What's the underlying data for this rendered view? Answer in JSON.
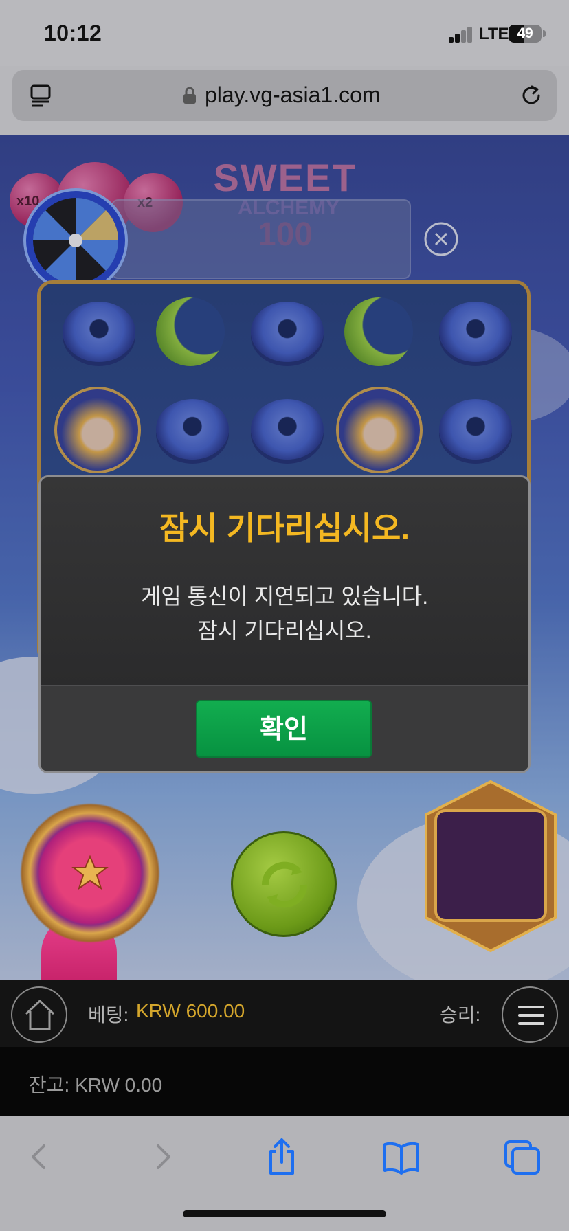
{
  "status_bar": {
    "time": "10:12",
    "network": "LTE",
    "battery": "49"
  },
  "address_bar": {
    "url": "play.vg-asia1.com"
  },
  "game": {
    "logo_line1": "SWEET",
    "logo_line2": "ALCHEMY",
    "logo_line3": "100",
    "multipliers": [
      "x10",
      "x2"
    ]
  },
  "dialog": {
    "title": "잠시 기다리십시오.",
    "message_line1": "게임 통신이 지연되고 있습니다.",
    "message_line2": "잠시 기다리십시오.",
    "confirm_label": "확인"
  },
  "bet_bar": {
    "bet_label": "베팅:",
    "bet_value": "KRW 600.00",
    "win_label": "승리:"
  },
  "balance_bar": {
    "balance_text": "잔고: KRW 0.00"
  },
  "colors": {
    "dialog_title": "#f4b822",
    "confirm_button": "#0a9a45",
    "bet_value": "#d4a62c"
  },
  "icons": [
    "tabs-icon",
    "lock-icon",
    "reload-icon",
    "wheel-icon",
    "close-icon",
    "home-icon",
    "menu-icon",
    "back-icon",
    "forward-icon",
    "share-icon",
    "bookmarks-icon",
    "tabs-overview-icon"
  ]
}
